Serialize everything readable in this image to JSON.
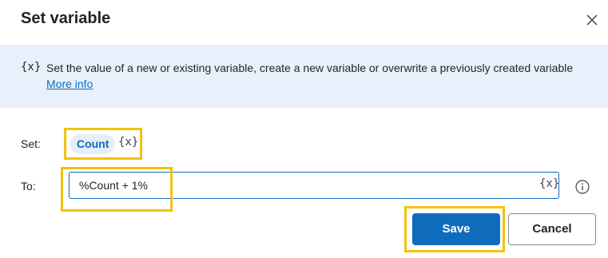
{
  "dialog": {
    "title": "Set variable",
    "close_icon": "close-icon"
  },
  "banner": {
    "icon_text": "{x}",
    "text": "Set the value of a new or existing variable, create a new variable or overwrite a previously created variable",
    "link": "More info"
  },
  "form": {
    "set_label": "Set:",
    "variable_name": "Count",
    "variable_picker_icon": "{x}",
    "to_label": "To:",
    "to_value": "%Count + 1%",
    "to_picker_icon": "{x}",
    "info_icon": "info-icon"
  },
  "buttons": {
    "save": "Save",
    "cancel": "Cancel"
  },
  "colors": {
    "accent": "#0f6cbd",
    "banner_bg": "#e8f1fb",
    "highlight": "#f2c20c"
  }
}
